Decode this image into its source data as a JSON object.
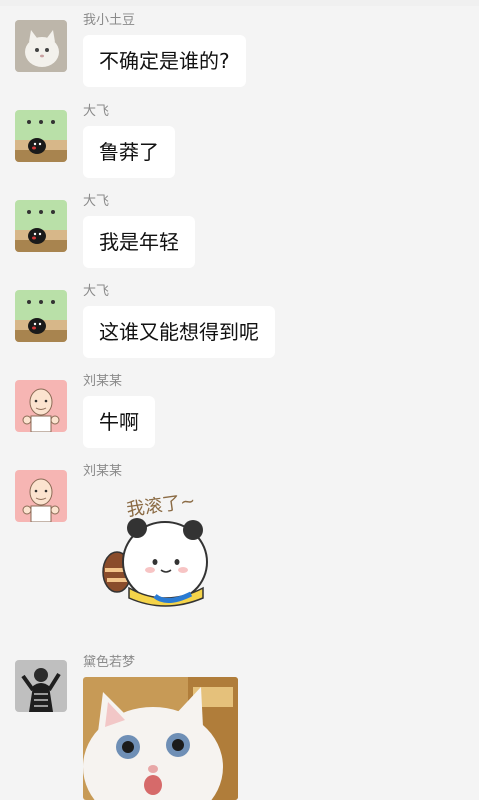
{
  "messages": [
    {
      "sender": "我小土豆",
      "text": "不确定是谁的?",
      "avatar": "white-cat-avatar"
    },
    {
      "sender": "大飞",
      "text": "鲁莽了",
      "avatar": "kumamon-avatar"
    },
    {
      "sender": "大飞",
      "text": "我是年轻",
      "avatar": "kumamon-avatar"
    },
    {
      "sender": "大飞",
      "text": "这谁又能想得到呢",
      "avatar": "kumamon-avatar"
    },
    {
      "sender": "刘某某",
      "text": "牛啊",
      "avatar": "old-man-cartoon-avatar"
    },
    {
      "sender": "刘某某",
      "sticker_text": "我滚了~",
      "avatar": "old-man-cartoon-avatar"
    },
    {
      "sender": "黛色若梦",
      "image": "white-cat-photo",
      "avatar": "person-photo-avatar"
    }
  ],
  "colors": {
    "background": "#f4f4f4",
    "bubble": "#ffffff",
    "sender": "#8a8a8a"
  }
}
